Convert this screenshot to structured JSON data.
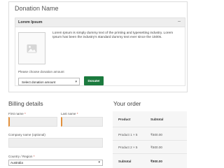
{
  "donation": {
    "title": "Donation Name",
    "item_title": "Lorem Ipsum",
    "toggle": "–",
    "description": "Lorem Ipsum is simply dummy text of the printing and typesetting industry. Lorem Ipsum has been the industry's standard dummy text ever since the 1500s.",
    "choose_label": "Please choose donation amount",
    "select_value": "Select donation amount",
    "donate_label": "Donate!"
  },
  "billing": {
    "title": "Billing details",
    "first_name_label": "First name",
    "last_name_label": "Last name",
    "company_label": "Company name (optional)",
    "country_label": "Country / Region",
    "country_value": "Australia",
    "required_mark": "*"
  },
  "order": {
    "title": "Your order",
    "header": [
      "Product",
      "Subtotal"
    ],
    "rows": [
      {
        "product": "Product 1 × 5",
        "subtotal": "₹500.00"
      },
      {
        "product": "Product 2 × 5",
        "subtotal": "₹500.00"
      }
    ],
    "subtotal_label": "Subtotal",
    "subtotal_value": "₹900.00"
  },
  "colors": {
    "accent_green": "#1b7a3e",
    "required_red": "#c0392b",
    "focus_orange": "#e2903c"
  }
}
